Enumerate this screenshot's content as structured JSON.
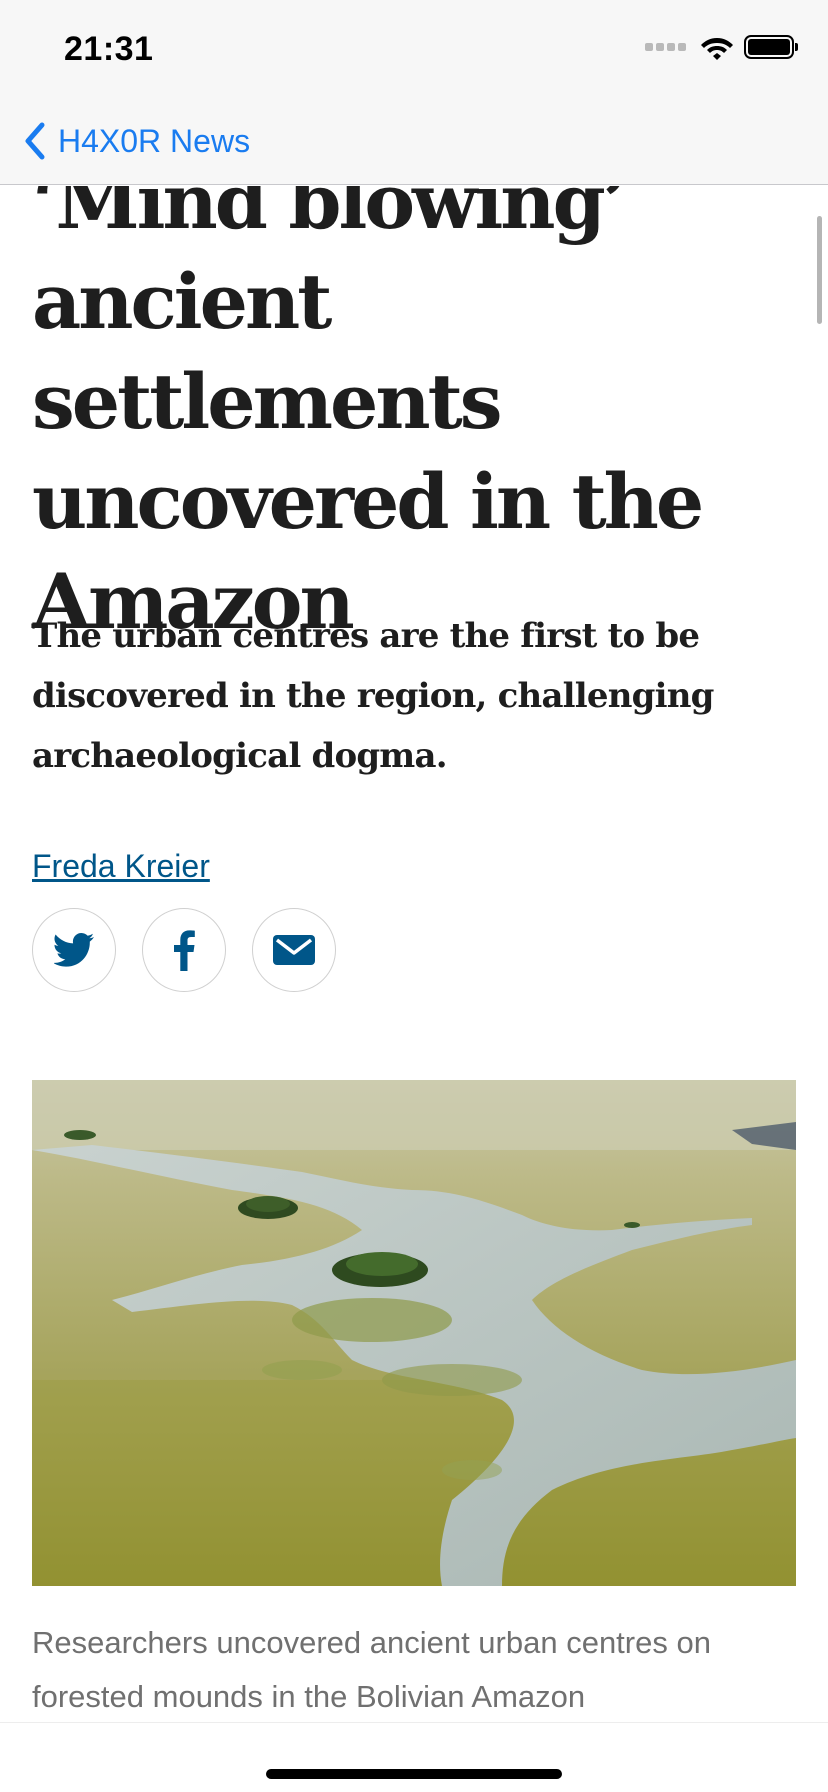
{
  "status_bar": {
    "time": "21:31"
  },
  "nav": {
    "back_label": "H4X0R News",
    "accent_color": "#1a7cf0"
  },
  "article": {
    "headline": "‘Mind blowing’ ancient settlements uncovered in the Amazon",
    "standfirst": "The urban centres are the first to be discovered in the region, challenging archaeological dogma.",
    "byline": "Freda Kreier",
    "share_buttons": [
      {
        "icon": "twitter-icon"
      },
      {
        "icon": "facebook-icon"
      },
      {
        "icon": "mail-icon"
      }
    ],
    "image_caption": "Researchers uncovered ancient urban centres on forested mounds in the Bolivian Amazon",
    "text_color": "#1e1e1e",
    "link_color": "#005689",
    "share_icon_color": "#005689"
  }
}
